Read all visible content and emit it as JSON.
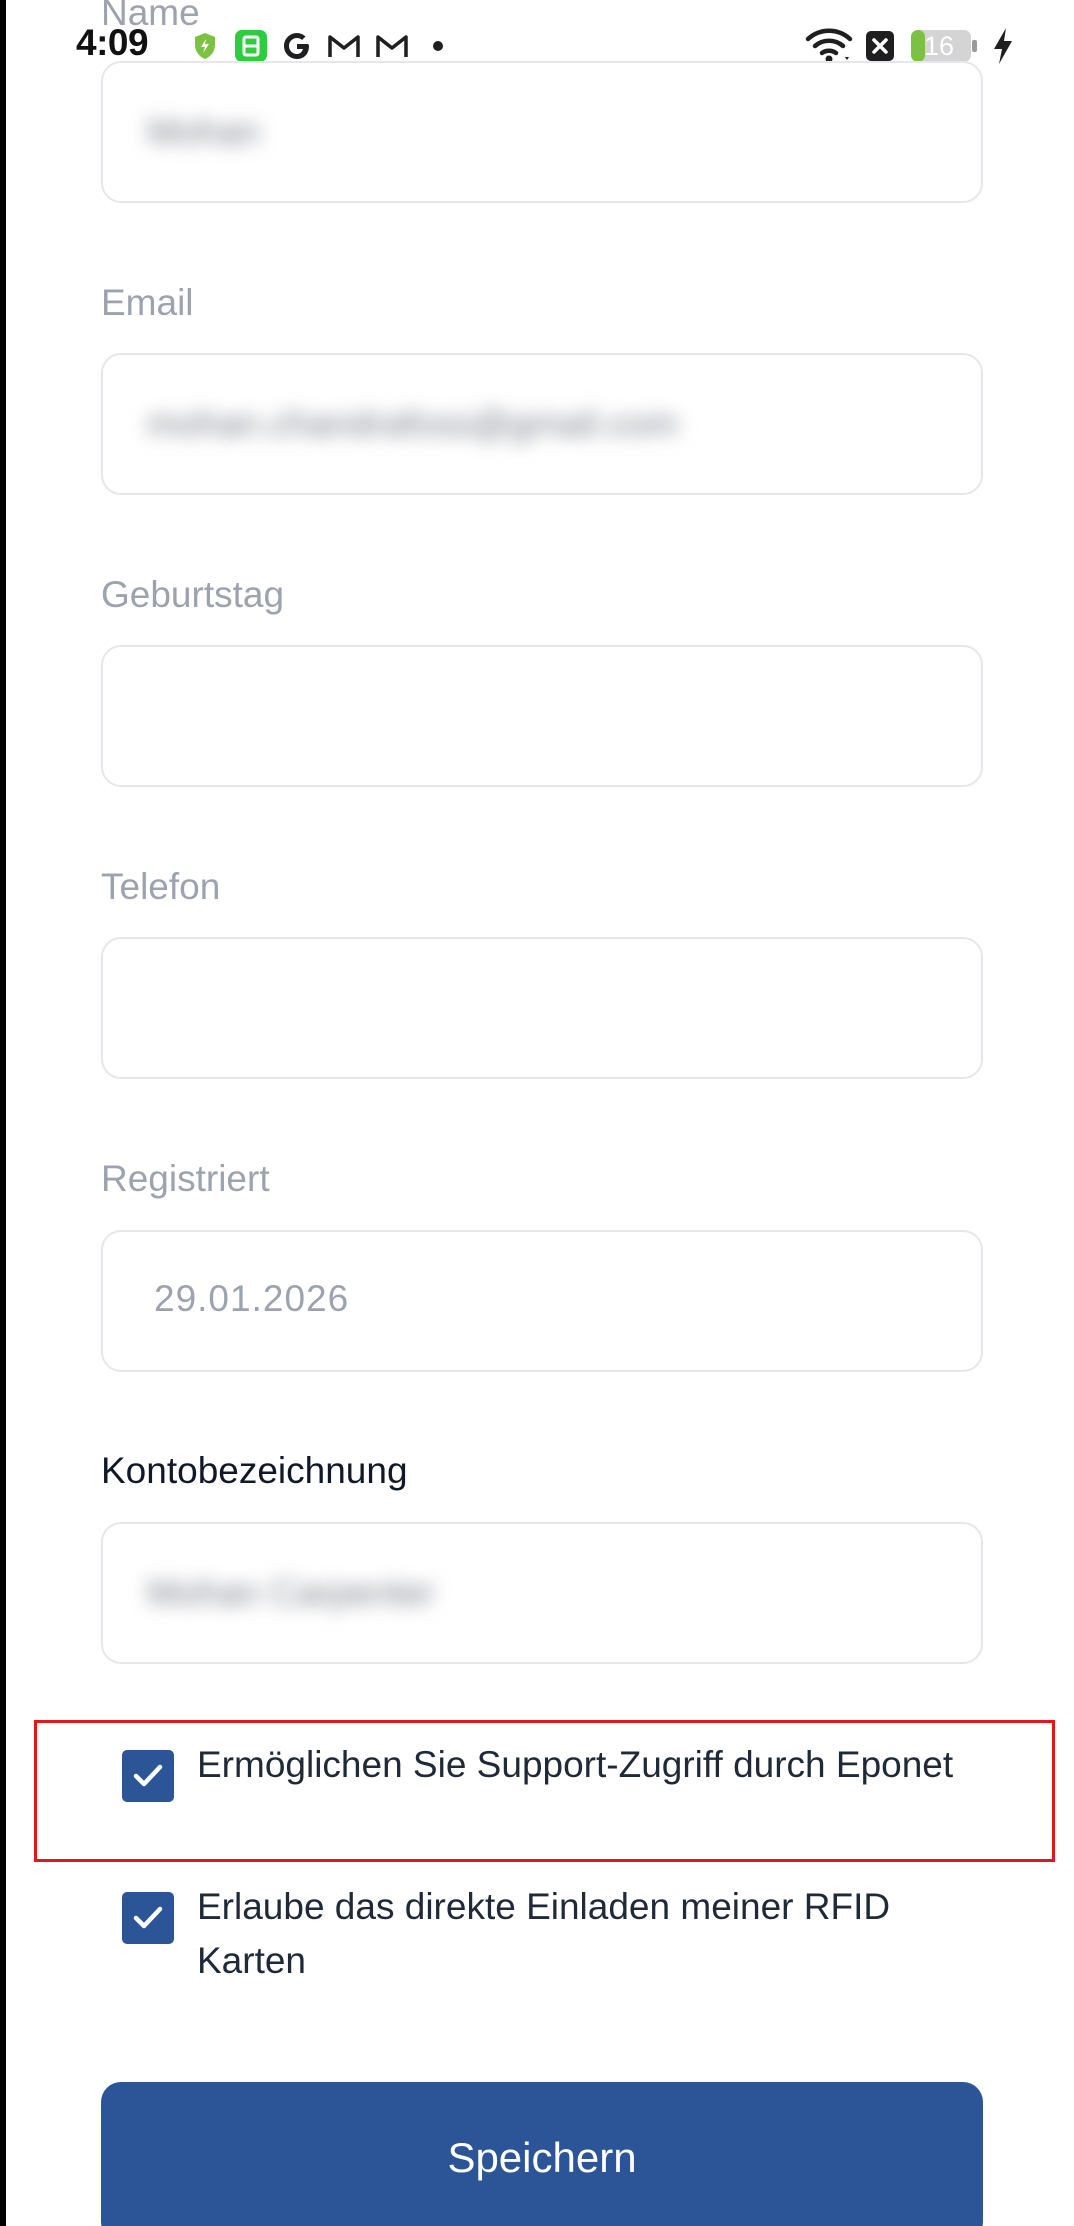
{
  "status_bar": {
    "time": "4:09",
    "battery": "16",
    "icons": [
      "shield-icon",
      "app-icon",
      "google-icon",
      "gmail-icon",
      "gmail-icon",
      "dot-icon",
      "wifi-icon",
      "close-box-icon",
      "battery-icon",
      "charging-icon"
    ]
  },
  "form": {
    "name": {
      "label": "Name",
      "value": "Mohan"
    },
    "email": {
      "label": "Email",
      "value": "mohan.chandrafoss@gmail.com"
    },
    "birthday": {
      "label": "Geburtstag",
      "value": ""
    },
    "phone": {
      "label": "Telefon",
      "value": ""
    },
    "registered": {
      "label": "Registriert",
      "value": "29.01.2026"
    },
    "account": {
      "label": "Kontobezeichnung",
      "value": "Mohan Carpenter"
    }
  },
  "checkboxes": [
    {
      "label": "Ermöglichen Sie Support-Zugriff durch Eponet",
      "checked": true
    },
    {
      "label": "Erlaube das direkte Einladen meiner RFID Karten",
      "checked": true
    }
  ],
  "save_label": "Speichern",
  "colors": {
    "primary": "#2c5597",
    "highlight": "#e01818",
    "label": "#9ca3af"
  }
}
